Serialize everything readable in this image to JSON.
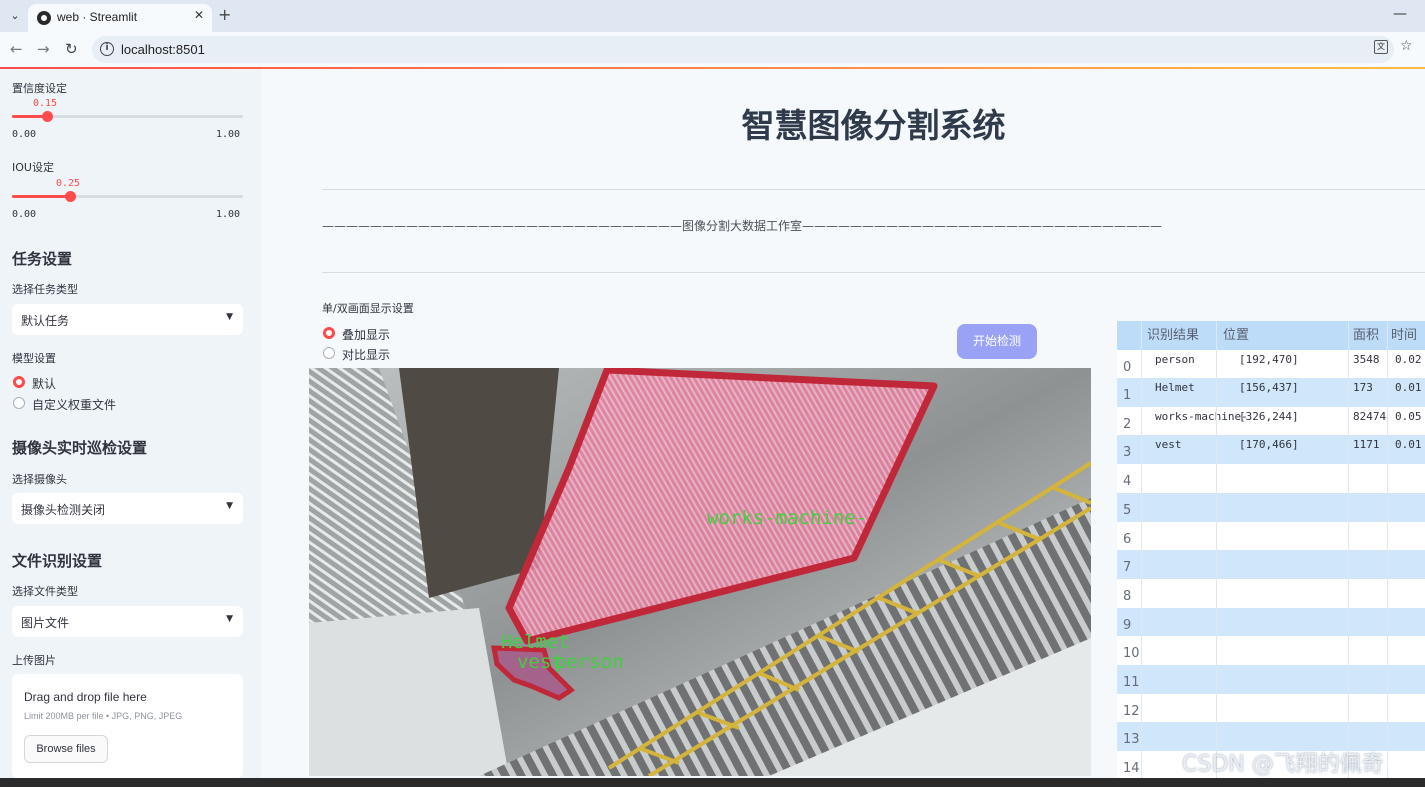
{
  "browser": {
    "tab_title": "web · Streamlit",
    "url": "localhost:8501",
    "close_glyph": "✕",
    "new_tab_glyph": "+",
    "minimize_glyph": "—",
    "back_glyph": "←",
    "forward_glyph": "→",
    "reload_glyph": "↻",
    "tab_list_glyph": "⌄",
    "star_glyph": "☆",
    "translate_glyph": "文"
  },
  "sidebar": {
    "confidence": {
      "label": "置信度设定",
      "value": "0.15",
      "min": "0.00",
      "max": "1.00",
      "fraction": 0.15
    },
    "iou": {
      "label": "IOU设定",
      "value": "0.25",
      "min": "0.00",
      "max": "1.00",
      "fraction": 0.25
    },
    "task_heading": "任务设置",
    "task_type_label": "选择任务类型",
    "task_type_value": "默认任务",
    "model_label": "模型设置",
    "model_options": [
      "默认",
      "自定义权重文件"
    ],
    "model_selected": 0,
    "camera_heading": "摄像头实时巡检设置",
    "camera_label": "选择摄像头",
    "camera_value": "摄像头检测关闭",
    "file_heading": "文件识别设置",
    "file_type_label": "选择文件类型",
    "file_type_value": "图片文件",
    "upload_label": "上传图片",
    "upload_drag": "Drag and drop file here",
    "upload_limit": "Limit 200MB per file • JPG, PNG, JPEG",
    "browse_label": "Browse files",
    "select_arrow": "▼"
  },
  "main": {
    "title": "智慧图像分割系统",
    "subtitle": "——————————————————————————————图像分割大数据工作室——————————————————————————————",
    "display_label": "单/双画面显示设置",
    "display_options": [
      "叠加显示",
      "对比显示"
    ],
    "display_selected": 0,
    "start_button": "开始检测",
    "detections": [
      {
        "label": "works-machine-",
        "color": "#3fd13f"
      },
      {
        "label": "Helmet",
        "color": "#3fd13f"
      },
      {
        "label": "vest",
        "color": "#3fd13f"
      },
      {
        "label": "person",
        "color": "#3fd13f"
      }
    ],
    "table": {
      "headers": [
        "",
        "识别结果",
        "位置",
        "面积",
        "时间"
      ],
      "rows": [
        {
          "index": "0",
          "result": "person",
          "position": "[192,470]",
          "area": "3548",
          "time": "0.02"
        },
        {
          "index": "1",
          "result": "Helmet",
          "position": "[156,437]",
          "area": "173",
          "time": "0.01"
        },
        {
          "index": "2",
          "result": "works-machine-",
          "position": "[326,244]",
          "area": "82474",
          "time": "0.05"
        },
        {
          "index": "3",
          "result": "vest",
          "position": "[170,466]",
          "area": "1171",
          "time": "0.01"
        },
        {
          "index": "4",
          "result": "",
          "position": "",
          "area": "",
          "time": ""
        },
        {
          "index": "5",
          "result": "",
          "position": "",
          "area": "",
          "time": ""
        },
        {
          "index": "6",
          "result": "",
          "position": "",
          "area": "",
          "time": ""
        },
        {
          "index": "7",
          "result": "",
          "position": "",
          "area": "",
          "time": ""
        },
        {
          "index": "8",
          "result": "",
          "position": "",
          "area": "",
          "time": ""
        },
        {
          "index": "9",
          "result": "",
          "position": "",
          "area": "",
          "time": ""
        },
        {
          "index": "10",
          "result": "",
          "position": "",
          "area": "",
          "time": ""
        },
        {
          "index": "11",
          "result": "",
          "position": "",
          "area": "",
          "time": ""
        },
        {
          "index": "12",
          "result": "",
          "position": "",
          "area": "",
          "time": ""
        },
        {
          "index": "13",
          "result": "",
          "position": "",
          "area": "",
          "time": ""
        },
        {
          "index": "14",
          "result": "",
          "position": "",
          "area": "",
          "time": ""
        }
      ]
    }
  },
  "watermark": "CSDN @飞翔的佩奇",
  "colors": {
    "accent": "#ff4b4b",
    "button": "#9aa2f5",
    "mask": "#f06a8e",
    "mask_outline": "#c0283a"
  }
}
